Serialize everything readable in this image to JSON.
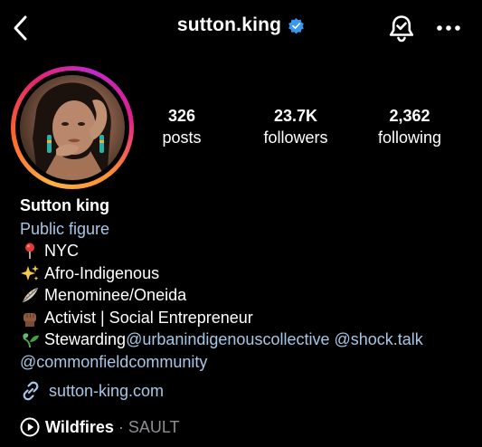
{
  "header": {
    "username": "sutton.king",
    "verified": true,
    "back_icon": "chevron-left-icon",
    "bell_icon": "bell-icon",
    "more_icon": "more-horizontal-icon"
  },
  "stats": [
    {
      "value": "326",
      "label": "posts"
    },
    {
      "value": "23.7K",
      "label": "followers"
    },
    {
      "value": "2,362",
      "label": "following"
    }
  ],
  "profile": {
    "display_name": "Sutton king",
    "category": "Public figure",
    "bio": {
      "line1": "NYC",
      "line2": "Afro-Indigenous",
      "line3": "Menominee/Oneida",
      "line4": "Activist | Social Entrepreneur",
      "line5_text": "Stewarding ",
      "mention1": "@urbanindigenouscollective",
      "mention2": "@shock.talk",
      "mention3": "@commonfieldcommunity"
    },
    "website": "sutton-king.com",
    "music": {
      "title": "Wildfires",
      "separator": "·",
      "artist": "SAULT"
    }
  },
  "colors": {
    "background": "#000000",
    "link": "#a7c7e7",
    "verified_badge": "#3897f0",
    "muted": "#8e8e93"
  }
}
